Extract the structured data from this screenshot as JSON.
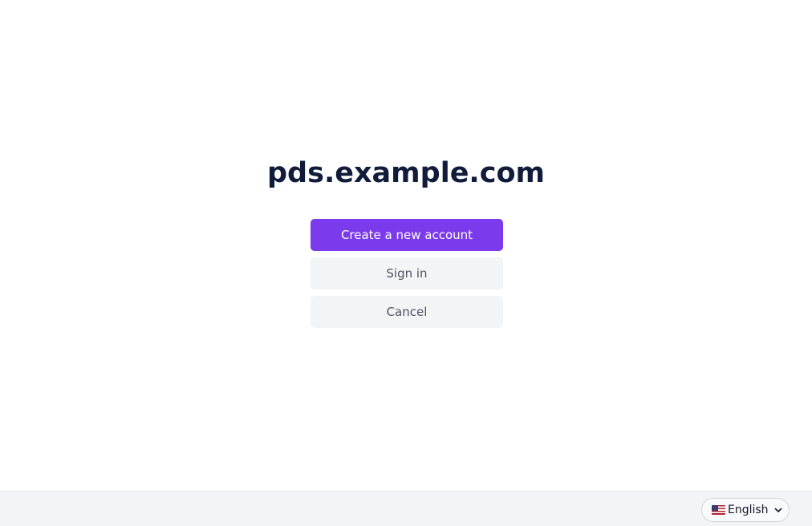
{
  "header": {
    "host_name": "pds.example.com"
  },
  "actions": {
    "create_account_label": "Create a new account",
    "sign_in_label": "Sign in",
    "cancel_label": "Cancel"
  },
  "footer": {
    "locale": {
      "flag_icon": "us-flag-icon",
      "selected_label": "English"
    }
  },
  "colors": {
    "primary": "#7c3aed",
    "secondary_bg": "#f3f4f6",
    "title_text": "#111c3a",
    "footer_bg": "#f3f4f6"
  }
}
